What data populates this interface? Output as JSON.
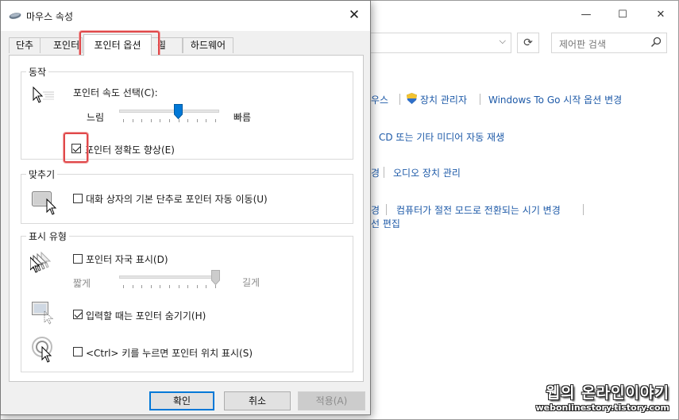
{
  "background_window": {
    "controls": {
      "minimize": "—",
      "maximize": "☐",
      "close": "✕"
    },
    "search_placeholder": "제어판 검색",
    "links": {
      "mouse": "우스",
      "device_manager": "장치 관리자",
      "windows_to_go": "Windows To Go 시작 옵션 변경",
      "cd_autoplay": "CD 또는 기타 미디어 자동 재생",
      "audio_partial": "경",
      "audio_devices": "오디오 장치 관리",
      "sleep_partial": "경",
      "sleep_time": "컴퓨터가 절전 모드로 전환되는 시기 변경",
      "edit_plan": "선 편집"
    },
    "icons": {
      "shield": "shield-icon",
      "refresh": "refresh-icon",
      "search": "search-icon"
    }
  },
  "dialog": {
    "title": "마우스 속성",
    "close_label": "✕",
    "tabs": [
      "단추",
      "포인터",
      "포인터 옵션",
      "휠",
      "하드웨어"
    ],
    "active_tab": "포인터 옵션",
    "motion": {
      "group_title": "동작",
      "speed_label": "포인터 속도 선택(C):",
      "slow": "느림",
      "fast": "빠름",
      "speed_value": 0.6,
      "precision_label": "포인터 정확도 향상(E)",
      "precision_checked": true
    },
    "snap": {
      "group_title": "맞추기",
      "snap_label": "대화 상자의 기본 단추로 포인터 자동 이동(U)",
      "snap_checked": false
    },
    "visibility": {
      "group_title": "표시 유형",
      "trails_label": "포인터 자국 표시(D)",
      "trails_checked": false,
      "short": "짧게",
      "long": "길게",
      "trails_value": 1.0,
      "hide_label": "입력할 때는 포인터 숨기기(H)",
      "hide_checked": true,
      "ctrl_label": "<Ctrl> 키를 누르면 포인터 위치 표시(S)",
      "ctrl_checked": false
    },
    "buttons": {
      "ok": "확인",
      "cancel": "취소",
      "apply": "적용(A)"
    }
  },
  "watermark": {
    "title": "웹의 온라인이야기",
    "url": "webonlinestory.tistory.com"
  },
  "colors": {
    "link": "#1e5aa8",
    "highlight": "#e0484a",
    "slider_thumb": "#0078d7",
    "default_button": "#0078d7"
  }
}
